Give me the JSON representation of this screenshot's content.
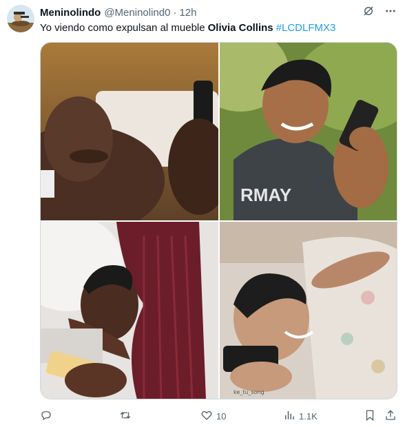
{
  "post": {
    "author_name": "Meninolindo",
    "author_handle": "@Meninolind0",
    "separator": "·",
    "time": "12h",
    "text": "Yo viendo como expulsan al mueble",
    "mention": "Olivia Collins",
    "hashtag": "#LCDLFMX3"
  },
  "media": {
    "watermark": "ke_tu_song"
  },
  "actions": {
    "reply_count": "",
    "retweet_count": "",
    "like_count": "10",
    "view_count": "1.1K"
  },
  "icons": {
    "grok": "grok-icon",
    "more": "more-icon",
    "reply": "reply-icon",
    "retweet": "retweet-icon",
    "like": "heart-icon",
    "views": "views-icon",
    "bookmark": "bookmark-icon",
    "share": "share-icon"
  },
  "colors": {
    "text": "#0f1419",
    "secondary": "#536471",
    "link": "#1d9bf0",
    "border": "#cfd9de"
  }
}
